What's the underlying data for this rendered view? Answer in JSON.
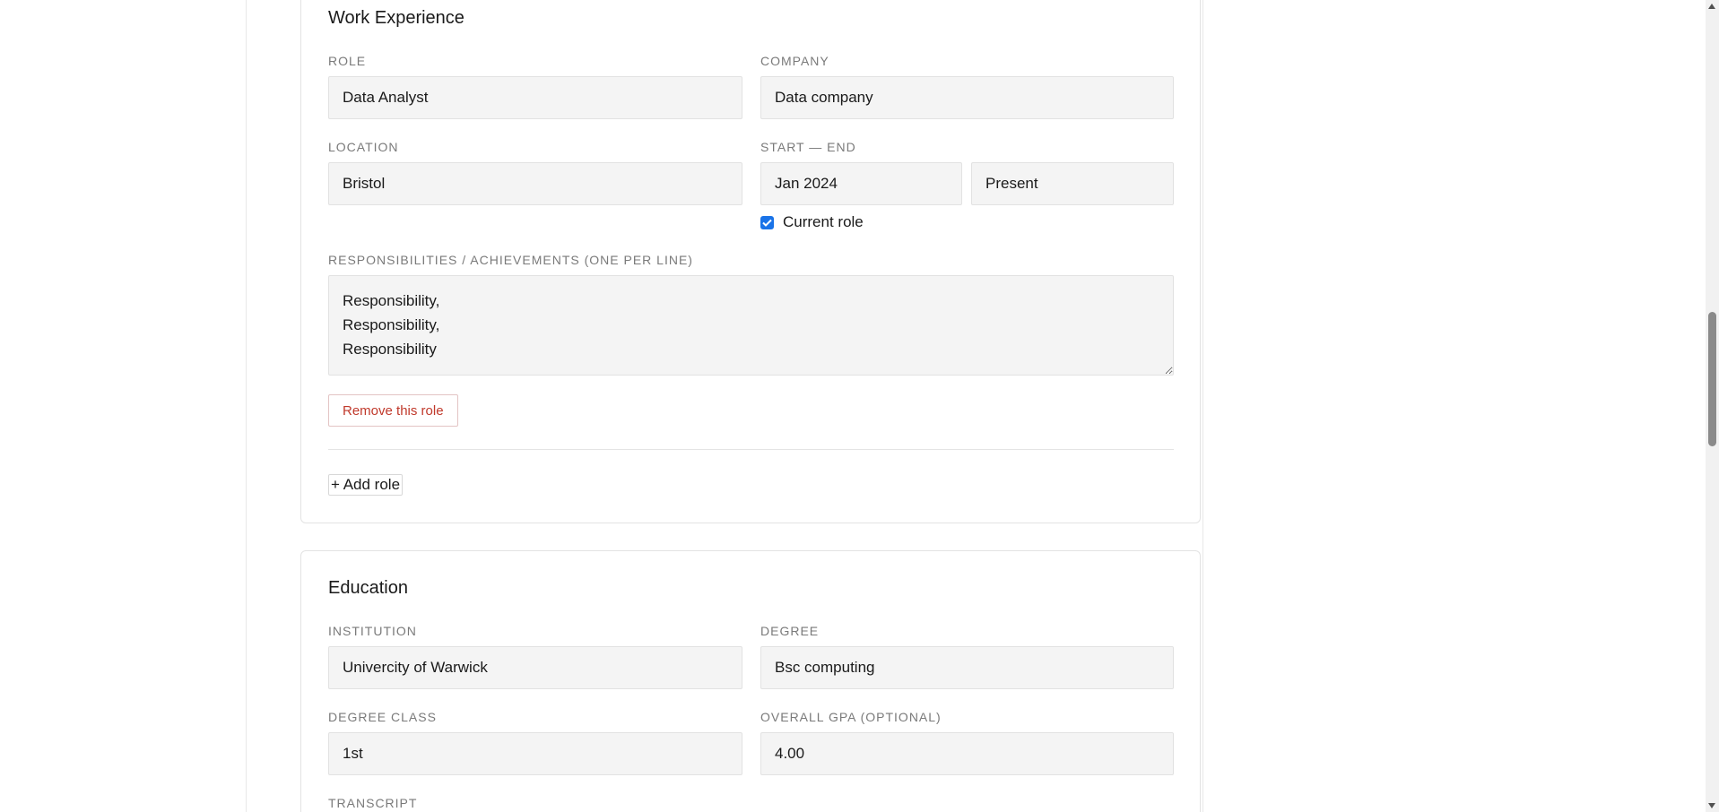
{
  "work_experience": {
    "title": "Work Experience",
    "role": {
      "label": "Role",
      "value": "Data Analyst"
    },
    "company": {
      "label": "Company",
      "value": "Data company"
    },
    "location": {
      "label": "Location",
      "value": "Bristol"
    },
    "start_end": {
      "label": "Start — End",
      "start": "Jan 2024",
      "end": "Present"
    },
    "current_role": {
      "label": "Current role",
      "checked": true
    },
    "responsibilities": {
      "label": "Responsibilities / Achievements (one per line)",
      "value": "Responsibility,\nResponsibility,\nResponsibility"
    },
    "remove_label": "Remove this role",
    "add_label": "+ Add role"
  },
  "education": {
    "title": "Education",
    "institution": {
      "label": "Institution",
      "value": "Univercity of Warwick"
    },
    "degree": {
      "label": "Degree",
      "value": "Bsc computing"
    },
    "degree_class": {
      "label": "Degree class",
      "value": "1st"
    },
    "gpa": {
      "label": "Overall GPA (optional)",
      "value": "4.00"
    },
    "transcript": {
      "label": "Transcript"
    }
  },
  "colors": {
    "accent": "#1a73e8",
    "danger": "#c0392b",
    "input_bg": "#f4f4f4"
  }
}
